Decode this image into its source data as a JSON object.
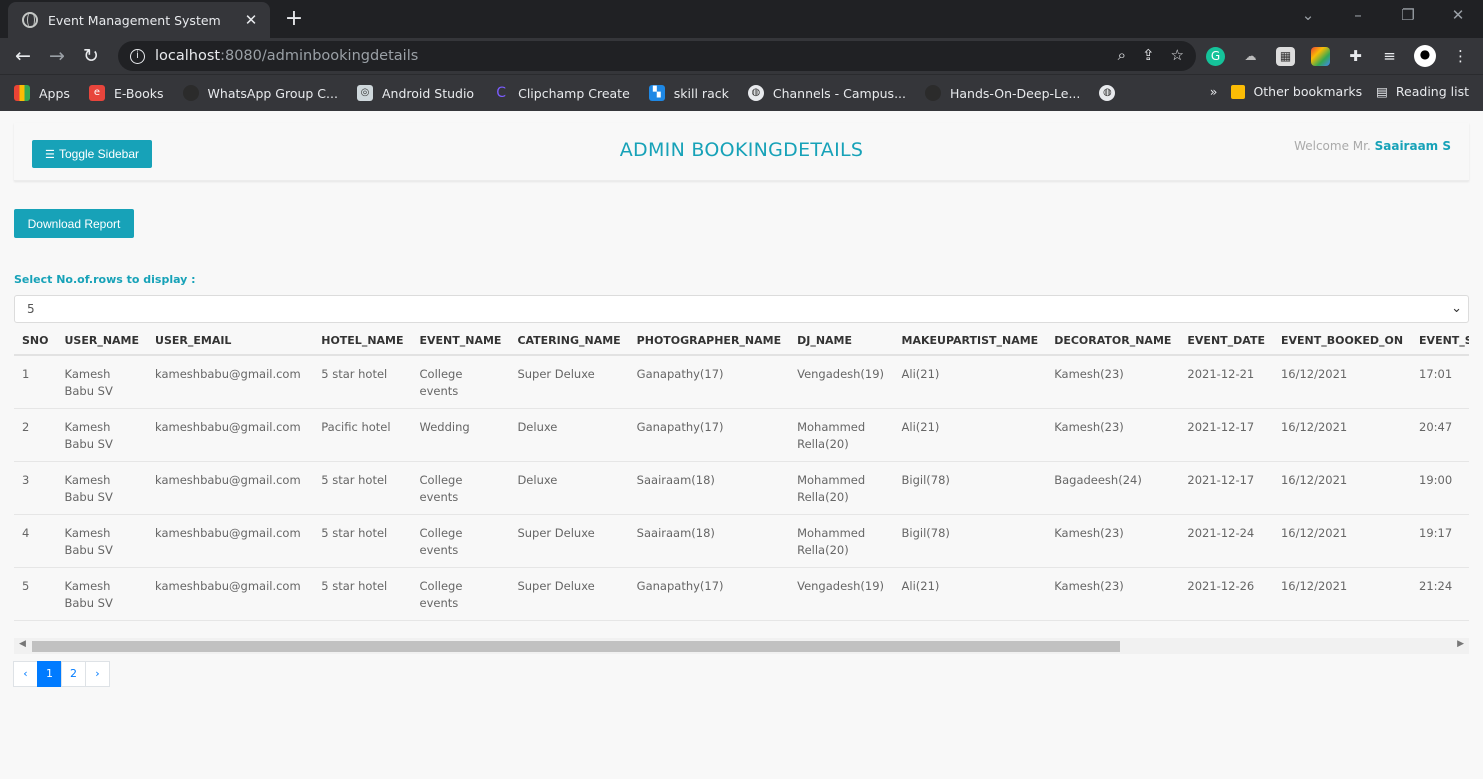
{
  "browser": {
    "tab_title": "Event Management System",
    "url_host": "localhost",
    "url_path": ":8080/adminbookingdetails",
    "bookmarks": [
      {
        "label": "Apps",
        "icon": "apps-grid-icon",
        "color": "#ea4335"
      },
      {
        "label": "E-Books",
        "icon": "ebooks-icon",
        "color": "#e8453c"
      },
      {
        "label": "WhatsApp Group C...",
        "icon": "github-icon",
        "color": "#3c3c3c"
      },
      {
        "label": "Android Studio",
        "icon": "android-studio-icon",
        "color": "#3ddc84"
      },
      {
        "label": "Clipchamp Create",
        "icon": "clipchamp-icon",
        "color": "#7b5cff"
      },
      {
        "label": "skill rack",
        "icon": "skillrack-icon",
        "color": "#1e88e5"
      },
      {
        "label": "Channels - Campus...",
        "icon": "globe-icon",
        "color": "#5f6368"
      },
      {
        "label": "Hands-On-Deep-Le...",
        "icon": "github-icon",
        "color": "#3c3c3c"
      }
    ],
    "other_bookmarks": "Other bookmarks",
    "reading_list": "Reading list"
  },
  "header": {
    "toggle_label": "Toggle Sidebar",
    "title": "ADMIN BOOKINGDETAILS",
    "welcome_prefix": "Welcome Mr.",
    "user_name": "Saairaam S"
  },
  "download_label": "Download Report",
  "rows_label": "Select No.of.rows to display :",
  "rows_value": "5",
  "table": {
    "columns": [
      "SNO",
      "USER_NAME",
      "USER_EMAIL",
      "HOTEL_NAME",
      "EVENT_NAME",
      "CATERING_NAME",
      "PHOTOGRAPHER_NAME",
      "DJ_NAME",
      "MAKEUPARTIST_NAME",
      "DECORATOR_NAME",
      "EVENT_DATE",
      "EVENT_BOOKED_ON",
      "EVENT_ST"
    ],
    "rows": [
      [
        "1",
        "Kamesh Babu SV",
        "kameshbabu@gmail.com",
        "5 star hotel",
        "College events",
        "Super Deluxe",
        "Ganapathy(17)",
        "Vengadesh(19)",
        "Ali(21)",
        "Kamesh(23)",
        "2021-12-21",
        "16/12/2021",
        "17:01"
      ],
      [
        "2",
        "Kamesh Babu SV",
        "kameshbabu@gmail.com",
        "Pacific hotel",
        "Wedding",
        "Deluxe",
        "Ganapathy(17)",
        "Mohammed Rella(20)",
        "Ali(21)",
        "Kamesh(23)",
        "2021-12-17",
        "16/12/2021",
        "20:47"
      ],
      [
        "3",
        "Kamesh Babu SV",
        "kameshbabu@gmail.com",
        "5 star hotel",
        "College events",
        "Deluxe",
        "Saairaam(18)",
        "Mohammed Rella(20)",
        "Bigil(78)",
        "Bagadeesh(24)",
        "2021-12-17",
        "16/12/2021",
        "19:00"
      ],
      [
        "4",
        "Kamesh Babu SV",
        "kameshbabu@gmail.com",
        "5 star hotel",
        "College events",
        "Super Deluxe",
        "Saairaam(18)",
        "Mohammed Rella(20)",
        "Bigil(78)",
        "Kamesh(23)",
        "2021-12-24",
        "16/12/2021",
        "19:17"
      ],
      [
        "5",
        "Kamesh Babu SV",
        "kameshbabu@gmail.com",
        "5 star hotel",
        "College events",
        "Super Deluxe",
        "Ganapathy(17)",
        "Vengadesh(19)",
        "Ali(21)",
        "Kamesh(23)",
        "2021-12-26",
        "16/12/2021",
        "21:24"
      ]
    ]
  },
  "pagination": {
    "prev": "‹",
    "pages": [
      "1",
      "2"
    ],
    "active": "1",
    "next": "›"
  },
  "colors": {
    "accent": "#17a2b8",
    "page_active": "#007bff"
  }
}
